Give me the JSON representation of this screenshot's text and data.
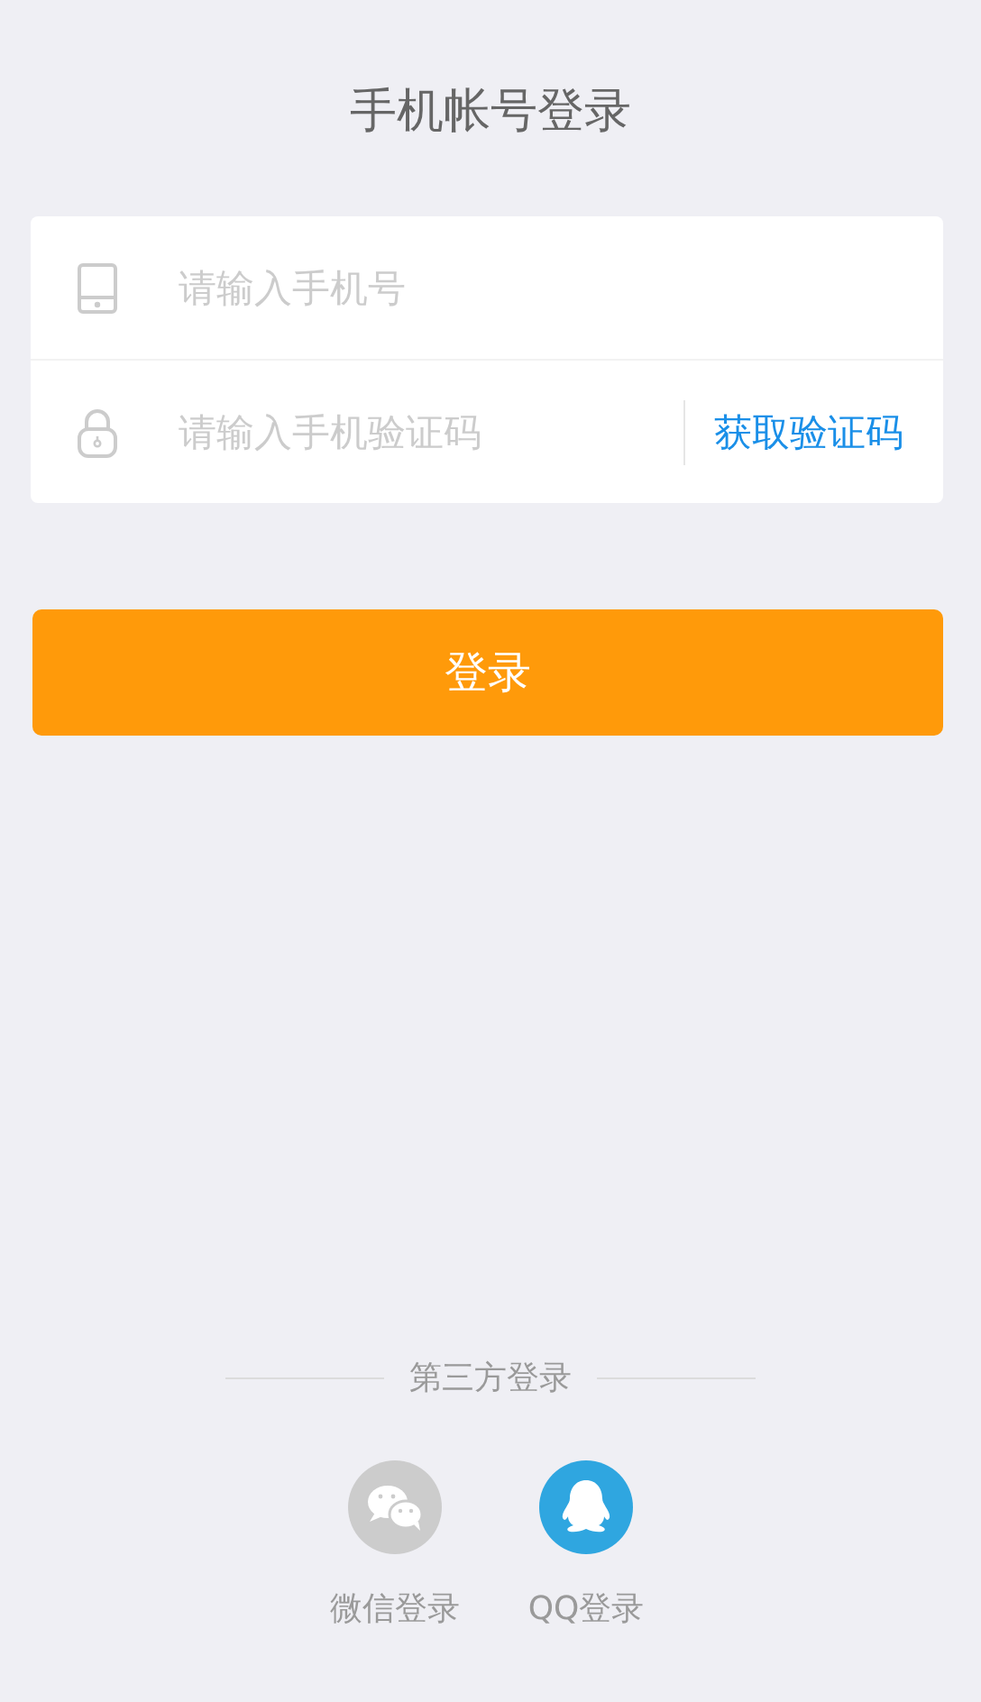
{
  "title": "手机帐号登录",
  "fields": [
    {
      "kind": "phone",
      "placeholder": "请输入手机号"
    },
    {
      "kind": "code",
      "placeholder": "请输入手机验证码",
      "action": "获取验证码"
    }
  ],
  "login_button": "登录",
  "third_party": {
    "label": "第三方登录",
    "providers": [
      {
        "kind": "wechat",
        "label": "微信登录",
        "color": "#cccccc"
      },
      {
        "kind": "qq",
        "label": "QQ登录",
        "color": "#2fa6e0"
      }
    ]
  }
}
